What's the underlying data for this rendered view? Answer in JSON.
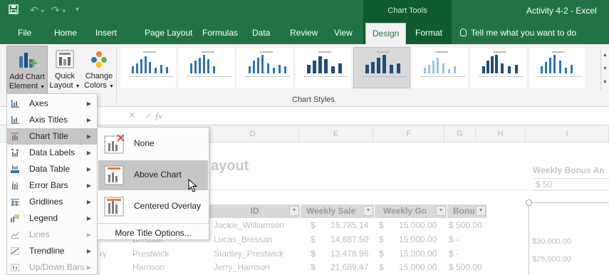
{
  "titlebar": {
    "save_icon": "save-icon",
    "undo_icon": "undo-icon",
    "redo_icon": "redo-icon",
    "customize_icon": "customize-quick-access-icon",
    "context_group": "Chart Tools",
    "window_title": "Activity 4-2 - Excel"
  },
  "tabs": {
    "file": "File",
    "home": "Home",
    "insert": "Insert",
    "page_layout": "Page Layout",
    "formulas": "Formulas",
    "data": "Data",
    "review": "Review",
    "view": "View",
    "design": "Design",
    "format": "Format",
    "tell_me": "Tell me what you want to do"
  },
  "ribbon": {
    "add_chart_element_line1": "Add Chart",
    "add_chart_element_line2": "Element",
    "quick_layout_line1": "Quick",
    "quick_layout_line2": "Layout",
    "change_colors_line1": "Change",
    "change_colors_line2": "Colors",
    "group_label": "Chart Styles",
    "colors": {
      "accent": "#217346",
      "dark_accent": "#0e5c2f",
      "bar_blue": "#2e75b6",
      "bar_navy": "#1f4e79"
    }
  },
  "add_chart_element_menu": [
    {
      "label": "Axes",
      "icon": "axes-icon",
      "enabled": true
    },
    {
      "label": "Axis Titles",
      "icon": "axis-titles-icon",
      "enabled": true
    },
    {
      "label": "Chart Title",
      "icon": "chart-title-icon",
      "enabled": true,
      "highlighted": true
    },
    {
      "label": "Data Labels",
      "icon": "data-labels-icon",
      "enabled": true
    },
    {
      "label": "Data Table",
      "icon": "data-table-icon",
      "enabled": true
    },
    {
      "label": "Error Bars",
      "icon": "error-bars-icon",
      "enabled": true
    },
    {
      "label": "Gridlines",
      "icon": "gridlines-icon",
      "enabled": true
    },
    {
      "label": "Legend",
      "icon": "legend-icon",
      "enabled": true
    },
    {
      "label": "Lines",
      "icon": "lines-icon",
      "enabled": false
    },
    {
      "label": "Trendline",
      "icon": "trendline-icon",
      "enabled": true
    },
    {
      "label": "Up/Down Bars",
      "icon": "up-down-bars-icon",
      "enabled": false
    }
  ],
  "chart_title_submenu": [
    {
      "label": "None",
      "icon": "chart-title-none-icon"
    },
    {
      "label": "Above Chart",
      "icon": "chart-title-above-icon",
      "highlighted": true
    },
    {
      "label": "Centered Overlay",
      "icon": "chart-title-overlay-icon"
    }
  ],
  "chart_title_more": "More Title Options...",
  "sheet": {
    "formula_fx": "fx",
    "columns": [
      "D",
      "E",
      "F",
      "G",
      "H",
      "I"
    ],
    "title": "ayout",
    "right_header": "Weekly Bonus An",
    "right_value": "$ 50",
    "table_headers": [
      "ID",
      "Weekly Sale",
      "Weekly Go",
      "Bonu"
    ],
    "rows": [
      {
        "first": "",
        "id": "Jackie_Williamson",
        "sales_sym": "$",
        "sales": "16,785.14",
        "goal_sym": "$",
        "goal": "15,000.00",
        "bonus": "$ 500.00"
      },
      {
        "first": "Bressan",
        "id": "Lucas_Bressan",
        "sales_sym": "$",
        "sales": "14,687.50",
        "goal_sym": "$",
        "goal": "15,000.00",
        "bonus": "$      -"
      },
      {
        "first": "Prestwick",
        "id": "Stanley_Prestwick",
        "sales_sym": "$",
        "sales": "13,478.96",
        "goal_sym": "$",
        "goal": "15,000.00",
        "bonus": "$      -"
      },
      {
        "first": "Harrison",
        "id": "Jerry_Harrison",
        "sales_sym": "$",
        "sales": "21,689.47",
        "goal_sym": "$",
        "goal": "15,000.00",
        "bonus": "$ 500.00"
      }
    ],
    "left_fragment": "ry",
    "axis_labels": [
      "$30,000.00",
      "$25,000.00"
    ]
  }
}
